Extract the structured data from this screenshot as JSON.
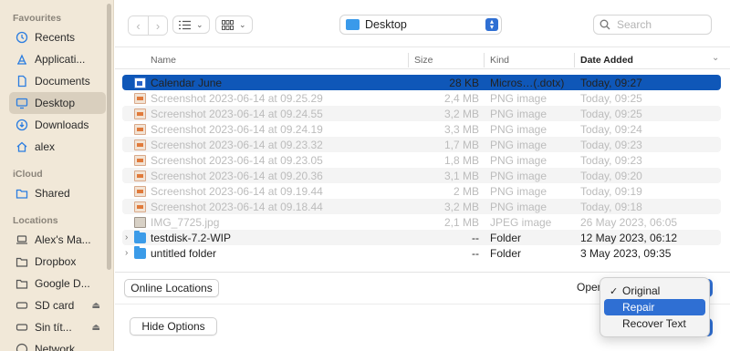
{
  "sidebar": {
    "sections": {
      "favourites": "Favourites",
      "icloud": "iCloud",
      "locations": "Locations"
    },
    "favourites": [
      {
        "label": "Recents",
        "icon": "clock-icon"
      },
      {
        "label": "Applicati...",
        "icon": "applications-icon"
      },
      {
        "label": "Documents",
        "icon": "document-icon"
      },
      {
        "label": "Desktop",
        "icon": "desktop-icon"
      },
      {
        "label": "Downloads",
        "icon": "download-icon"
      },
      {
        "label": "alex",
        "icon": "home-icon"
      }
    ],
    "icloud": [
      {
        "label": "Shared",
        "icon": "shared-folder-icon"
      }
    ],
    "locations": [
      {
        "label": "Alex's Ma...",
        "icon": "laptop-icon"
      },
      {
        "label": "Dropbox",
        "icon": "folder-icon"
      },
      {
        "label": "Google D...",
        "icon": "folder-icon"
      },
      {
        "label": "SD card",
        "icon": "drive-icon",
        "eject": "⏏"
      },
      {
        "label": "Sin tít...",
        "icon": "drive-icon",
        "eject": "⏏"
      },
      {
        "label": "Network",
        "icon": "network-icon"
      }
    ]
  },
  "toolbar": {
    "location": "Desktop",
    "search_placeholder": "Search"
  },
  "columns": {
    "name": "Name",
    "size": "Size",
    "kind": "Kind",
    "date": "Date Added"
  },
  "files": [
    {
      "name": "Calendar June",
      "size": "28 KB",
      "kind": "Micros…(.dotx)",
      "date": "Today, 09:27",
      "icon": "doc"
    },
    {
      "name": "Screenshot 2023-06-14 at 09.25.29",
      "size": "2,4 MB",
      "kind": "PNG image",
      "date": "Today, 09:25",
      "icon": "png"
    },
    {
      "name": "Screenshot 2023-06-14 at 09.24.55",
      "size": "3,2 MB",
      "kind": "PNG image",
      "date": "Today, 09:25",
      "icon": "png"
    },
    {
      "name": "Screenshot 2023-06-14 at 09.24.19",
      "size": "3,3 MB",
      "kind": "PNG image",
      "date": "Today, 09:24",
      "icon": "png"
    },
    {
      "name": "Screenshot 2023-06-14 at 09.23.32",
      "size": "1,7 MB",
      "kind": "PNG image",
      "date": "Today, 09:23",
      "icon": "png"
    },
    {
      "name": "Screenshot 2023-06-14 at 09.23.05",
      "size": "1,8 MB",
      "kind": "PNG image",
      "date": "Today, 09:23",
      "icon": "png"
    },
    {
      "name": "Screenshot 2023-06-14 at 09.20.36",
      "size": "3,1 MB",
      "kind": "PNG image",
      "date": "Today, 09:20",
      "icon": "png"
    },
    {
      "name": "Screenshot 2023-06-14 at 09.19.44",
      "size": "2 MB",
      "kind": "PNG image",
      "date": "Today, 09:19",
      "icon": "png"
    },
    {
      "name": "Screenshot 2023-06-14 at 09.18.44",
      "size": "3,2 MB",
      "kind": "PNG image",
      "date": "Today, 09:18",
      "icon": "png"
    },
    {
      "name": "IMG_7725.jpg",
      "size": "2,1 MB",
      "kind": "JPEG image",
      "date": "26 May 2023, 06:05",
      "icon": "jpg"
    },
    {
      "name": "testdisk-7.2-WIP",
      "size": "--",
      "kind": "Folder",
      "date": "12 May 2023, 06:12",
      "icon": "folder"
    },
    {
      "name": "untitled folder",
      "size": "--",
      "kind": "Folder",
      "date": "3 May 2023, 09:35",
      "icon": "folder"
    }
  ],
  "bottom": {
    "online_locations": "Online Locations",
    "open_label": "Open",
    "hide_options": "Hide Options"
  },
  "open_menu": {
    "checkmark": "✓",
    "items": [
      {
        "label": "Original",
        "checked": true
      },
      {
        "label": "Repair",
        "highlighted": true
      },
      {
        "label": "Recover Text"
      }
    ]
  }
}
